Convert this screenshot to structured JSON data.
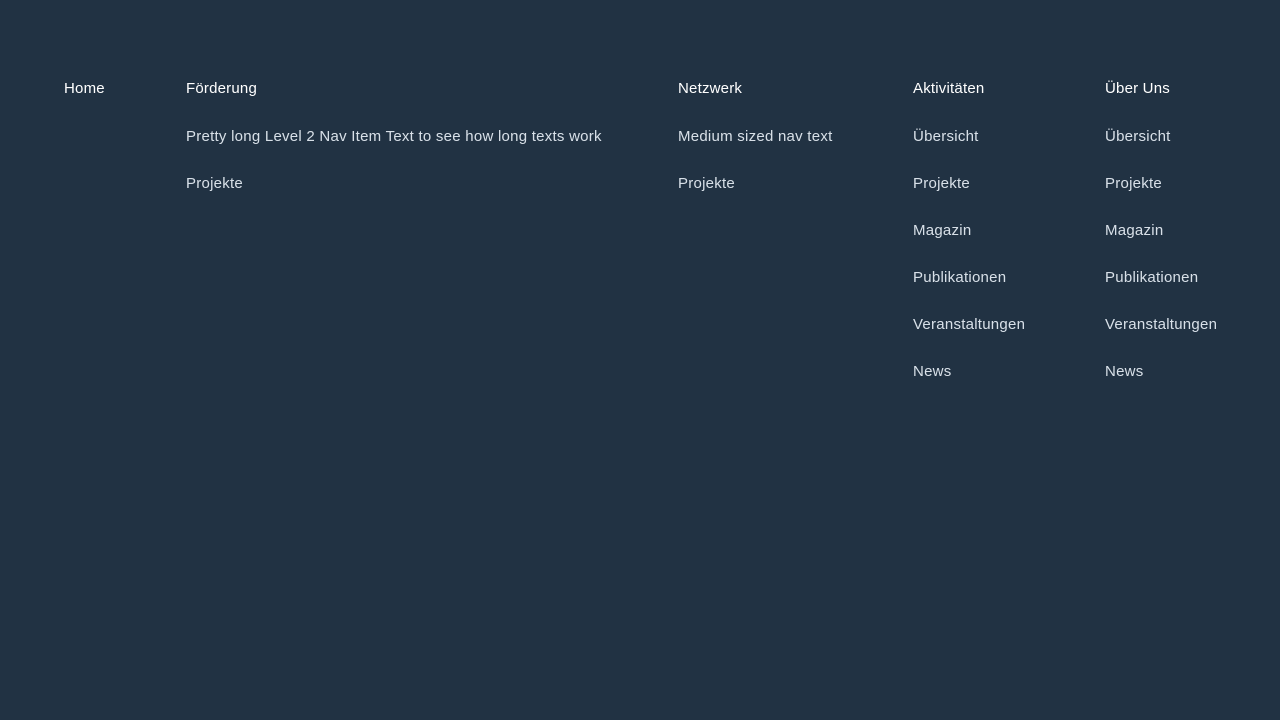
{
  "nav": {
    "columns": [
      {
        "label": "Home",
        "items": []
      },
      {
        "label": "Förderung",
        "items": [
          "Pretty long Level 2 Nav Item Text to see how long texts work",
          "Projekte"
        ]
      },
      {
        "label": "Netzwerk",
        "items": [
          "Medium sized nav text",
          "Projekte"
        ]
      },
      {
        "label": "Aktivitäten",
        "items": [
          "Übersicht",
          "Projekte",
          "Magazin",
          "Publikationen",
          "Veranstaltungen",
          "News"
        ]
      },
      {
        "label": "Über Uns",
        "items": [
          "Übersicht",
          "Projekte",
          "Magazin",
          "Publikationen",
          "Veranstaltungen",
          "News"
        ]
      }
    ]
  },
  "colors": {
    "background": "#213243",
    "level1_text": "#ffffff",
    "level2_text": "#d8e0e8"
  }
}
